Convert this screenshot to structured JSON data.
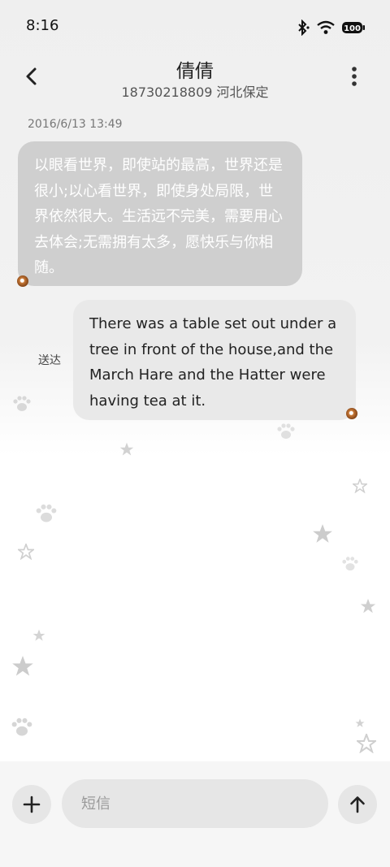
{
  "status_bar": {
    "time": "8:16",
    "battery_level": "100"
  },
  "header": {
    "contact_name": "倩倩",
    "contact_subtitle": "18730218809 河北保定"
  },
  "messages": {
    "timestamp": "2016/6/13 13:49",
    "incoming_text": "以眼看世界，即使站的最高，世界还是很小;以心看世界，即使身处局限，世界依然很大。生活远不完美，需要用心去体会;无需拥有太多，愿快乐与你相随。",
    "outgoing_text": "There was a table set out under a tree in front of the house,and the March Hare and the Hatter were having tea at it.",
    "outgoing_status": "送达"
  },
  "composer": {
    "placeholder": "短信"
  },
  "icons": {
    "back": "chevron-left-icon",
    "more": "more-vertical-icon",
    "attach": "plus-icon",
    "send": "arrow-up-icon"
  },
  "colors": {
    "incoming_bubble": "#cfcfcf",
    "outgoing_bubble": "#e9e9e9",
    "input_background": "#e6e6e6"
  }
}
